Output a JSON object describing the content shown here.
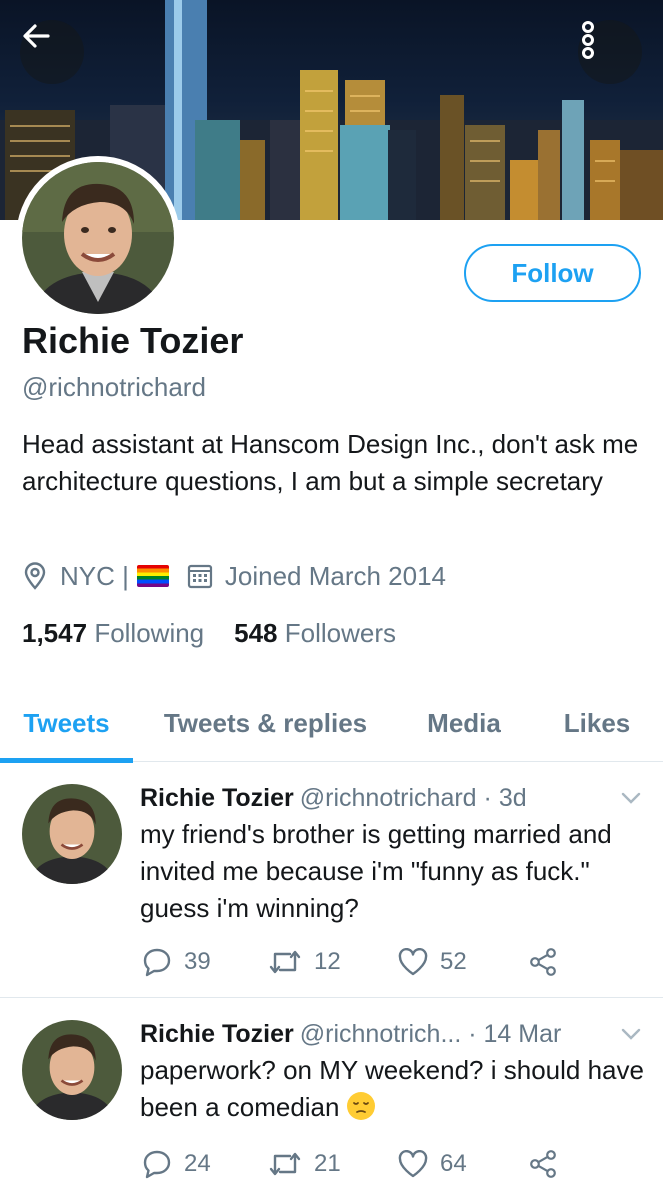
{
  "header": {
    "back_icon": "arrow-left-icon",
    "more_icon": "more-vertical-icon"
  },
  "profile": {
    "name": "Richie Tozier",
    "handle": "@richnotrichard",
    "follow_label": "Follow",
    "bio": "Head assistant at Hanscom Design Inc., don't ask me architecture questions, I am but a simple secretary",
    "location": "NYC |",
    "joined": "Joined March 2014",
    "following_count": "1,547",
    "following_label": "Following",
    "followers_count": "548",
    "followers_label": "Followers"
  },
  "tabs": [
    {
      "label": "Tweets",
      "active": true
    },
    {
      "label": "Tweets & replies",
      "active": false
    },
    {
      "label": "Media",
      "active": false
    },
    {
      "label": "Likes",
      "active": false
    }
  ],
  "tweets": [
    {
      "name": "Richie Tozier",
      "handle": "@richnotrichard",
      "time": "· 3d",
      "text": "my friend's brother is getting married and invited me because i'm \"funny as fuck.\" guess i'm winning?",
      "replies": "39",
      "retweets": "12",
      "likes": "52"
    },
    {
      "name": "Richie Tozier",
      "handle": "@richnotrich...",
      "time": "· 14 Mar",
      "text": "paperwork? on MY weekend? i should have been a comedian",
      "replies": "24",
      "retweets": "21",
      "likes": "64"
    }
  ],
  "colors": {
    "accent": "#1da1f2",
    "muted": "#657786",
    "text": "#14171a"
  }
}
